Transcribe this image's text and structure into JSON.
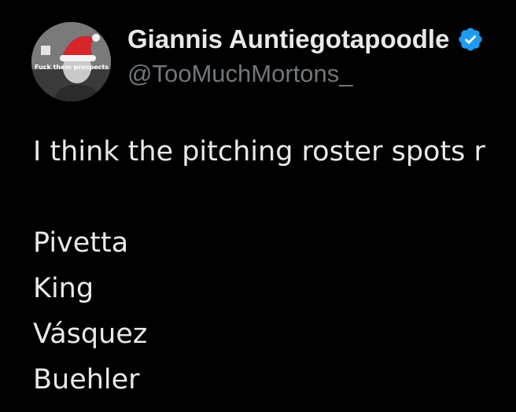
{
  "user": {
    "display_name": "Giannis Auntiegotapoodle",
    "handle": "@TooMuchMortons_",
    "avatar_caption": "Fuck them prospects",
    "verified_color": "#1d9bf0"
  },
  "tweet": {
    "intro": "I think the pitching roster spots r",
    "pitchers": [
      "Pivetta",
      "King",
      "Vásquez",
      "Buehler"
    ]
  },
  "colors": {
    "background": "#000000",
    "text": "#e7e9ea",
    "muted": "#71767b"
  }
}
